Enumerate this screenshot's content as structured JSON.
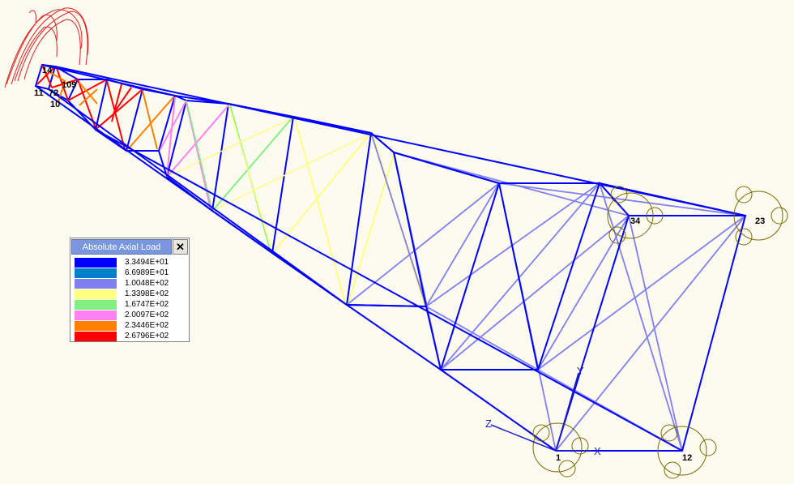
{
  "legend": {
    "title": "Absolute Axial Load",
    "close_label": "✕",
    "entries": [
      {
        "value": "3.3494E+01",
        "color": "#0000ff"
      },
      {
        "value": "6.6989E+01",
        "color": "#0080c8"
      },
      {
        "value": "1.0048E+02",
        "color": "#8080f0"
      },
      {
        "value": "1.3398E+02",
        "color": "#ffff80"
      },
      {
        "value": "1.6747E+02",
        "color": "#80f080"
      },
      {
        "value": "2.0097E+02",
        "color": "#ff80f0"
      },
      {
        "value": "2.3446E+02",
        "color": "#ff8000"
      },
      {
        "value": "2.6796E+02",
        "color": "#ff0000"
      }
    ]
  },
  "nodes": {
    "n1": "1",
    "n12": "12",
    "n23": "23",
    "n34": "34",
    "n11": "11",
    "n14": "14",
    "n72": "72",
    "n109": "109",
    "n10": "10"
  },
  "axes": {
    "x": "X",
    "y": "Y",
    "z": "Z"
  },
  "colors": {
    "background": "#fdfbf0",
    "support_symbol": "#7a6a00",
    "deformed_shape": "#e02020",
    "axis": "#2020c8"
  }
}
